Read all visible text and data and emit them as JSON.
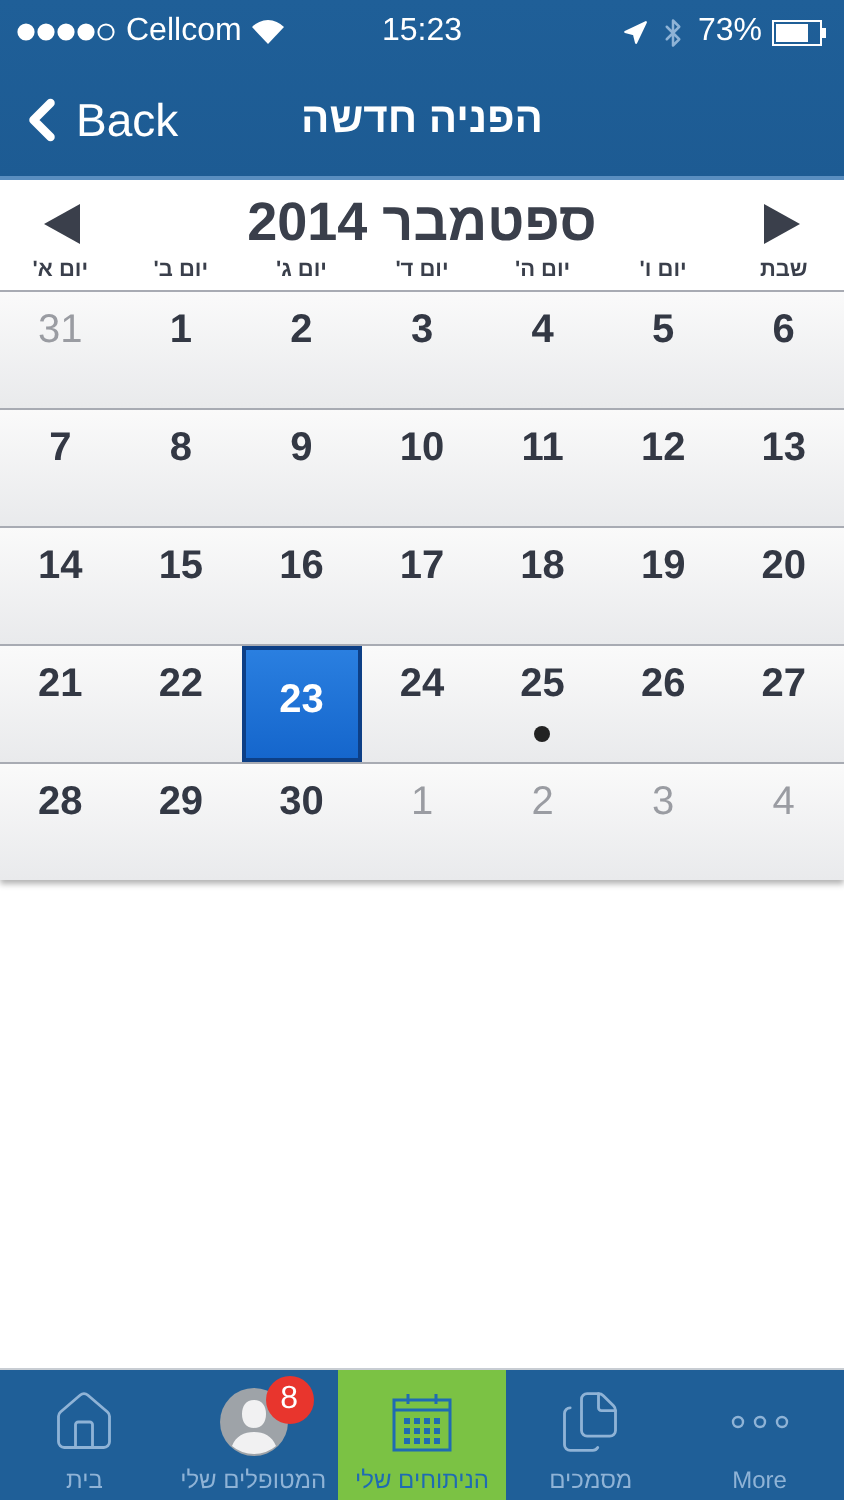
{
  "status_bar": {
    "carrier": "Cellcom",
    "time": "15:23",
    "battery": "73%"
  },
  "nav": {
    "back": "Back",
    "title": "הפניה חדשה"
  },
  "calendar": {
    "month_title": "ספטמבר 2014",
    "weekdays": [
      "שבת",
      "יום ו'",
      "יום ה'",
      "יום ד'",
      "יום ג'",
      "יום ב'",
      "יום א'"
    ],
    "weeks": [
      [
        {
          "day": "6",
          "in_month": true,
          "selected": false,
          "has_event": false
        },
        {
          "day": "5",
          "in_month": true,
          "selected": false,
          "has_event": false
        },
        {
          "day": "4",
          "in_month": true,
          "selected": false,
          "has_event": false
        },
        {
          "day": "3",
          "in_month": true,
          "selected": false,
          "has_event": false
        },
        {
          "day": "2",
          "in_month": true,
          "selected": false,
          "has_event": false
        },
        {
          "day": "1",
          "in_month": true,
          "selected": false,
          "has_event": false
        },
        {
          "day": "31",
          "in_month": false,
          "selected": false,
          "has_event": false
        }
      ],
      [
        {
          "day": "13",
          "in_month": true,
          "selected": false,
          "has_event": false
        },
        {
          "day": "12",
          "in_month": true,
          "selected": false,
          "has_event": false
        },
        {
          "day": "11",
          "in_month": true,
          "selected": false,
          "has_event": false
        },
        {
          "day": "10",
          "in_month": true,
          "selected": false,
          "has_event": false
        },
        {
          "day": "9",
          "in_month": true,
          "selected": false,
          "has_event": false
        },
        {
          "day": "8",
          "in_month": true,
          "selected": false,
          "has_event": false
        },
        {
          "day": "7",
          "in_month": true,
          "selected": false,
          "has_event": false
        }
      ],
      [
        {
          "day": "20",
          "in_month": true,
          "selected": false,
          "has_event": false
        },
        {
          "day": "19",
          "in_month": true,
          "selected": false,
          "has_event": false
        },
        {
          "day": "18",
          "in_month": true,
          "selected": false,
          "has_event": false
        },
        {
          "day": "17",
          "in_month": true,
          "selected": false,
          "has_event": false
        },
        {
          "day": "16",
          "in_month": true,
          "selected": false,
          "has_event": false
        },
        {
          "day": "15",
          "in_month": true,
          "selected": false,
          "has_event": false
        },
        {
          "day": "14",
          "in_month": true,
          "selected": false,
          "has_event": false
        }
      ],
      [
        {
          "day": "27",
          "in_month": true,
          "selected": false,
          "has_event": false
        },
        {
          "day": "26",
          "in_month": true,
          "selected": false,
          "has_event": false
        },
        {
          "day": "25",
          "in_month": true,
          "selected": false,
          "has_event": true
        },
        {
          "day": "24",
          "in_month": true,
          "selected": false,
          "has_event": false
        },
        {
          "day": "23",
          "in_month": true,
          "selected": true,
          "has_event": false
        },
        {
          "day": "22",
          "in_month": true,
          "selected": false,
          "has_event": false
        },
        {
          "day": "21",
          "in_month": true,
          "selected": false,
          "has_event": false
        }
      ],
      [
        {
          "day": "4",
          "in_month": false,
          "selected": false,
          "has_event": false
        },
        {
          "day": "3",
          "in_month": false,
          "selected": false,
          "has_event": false
        },
        {
          "day": "2",
          "in_month": false,
          "selected": false,
          "has_event": false
        },
        {
          "day": "1",
          "in_month": false,
          "selected": false,
          "has_event": false
        },
        {
          "day": "30",
          "in_month": true,
          "selected": false,
          "has_event": false
        },
        {
          "day": "29",
          "in_month": true,
          "selected": false,
          "has_event": false
        },
        {
          "day": "28",
          "in_month": true,
          "selected": false,
          "has_event": false
        }
      ]
    ]
  },
  "tab_bar": [
    {
      "kind": "more",
      "label": "More",
      "selected": false
    },
    {
      "kind": "documents",
      "label": "מסמכים",
      "selected": false
    },
    {
      "kind": "calendar",
      "label": "הניתוחים שלי",
      "selected": true
    },
    {
      "kind": "person",
      "label": "המטופלים שלי",
      "selected": false,
      "badge": "8"
    },
    {
      "kind": "home",
      "label": "בית",
      "selected": false
    }
  ]
}
